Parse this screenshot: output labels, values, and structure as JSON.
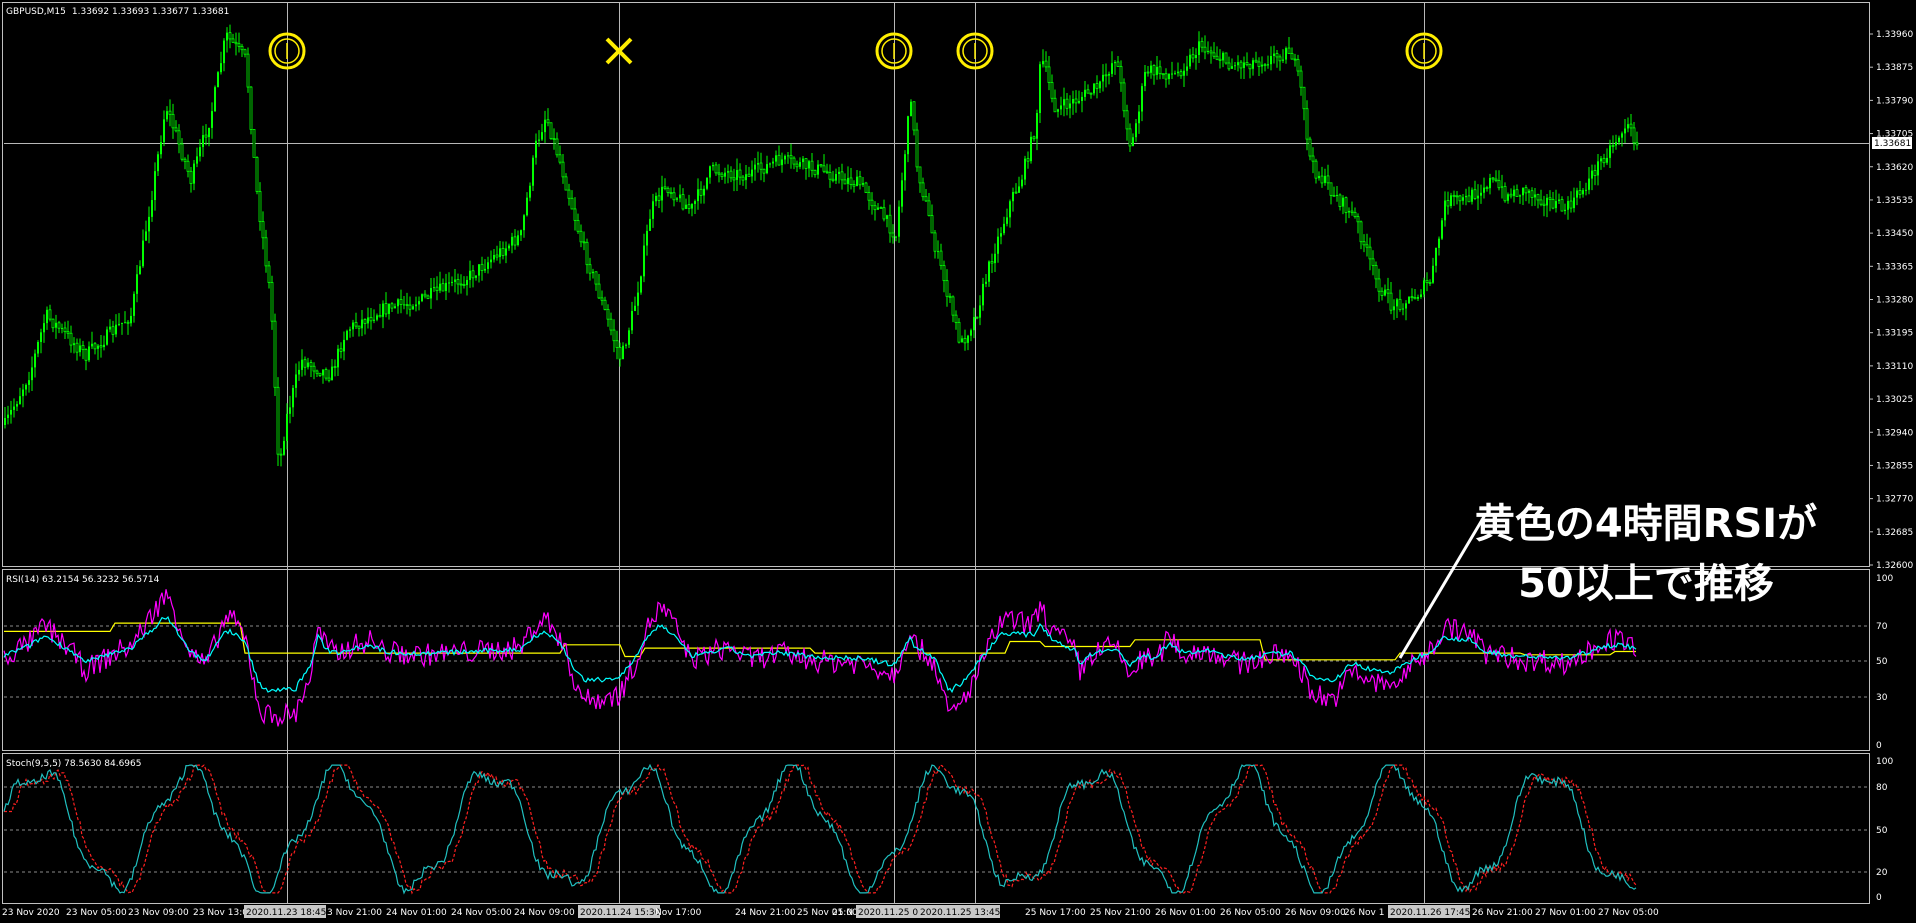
{
  "main_panel": {
    "symbol_label": "GBPUSD,M15",
    "ohlc_values": "1.33692 1.33693 1.33677 1.33681",
    "price_ticks": [
      "1.33960",
      "1.33875",
      "1.33790",
      "1.33705",
      "1.33620",
      "1.33535",
      "1.33450",
      "1.33365",
      "1.33280",
      "1.33195",
      "1.33110",
      "1.33025",
      "1.32940",
      "1.32855",
      "1.32770",
      "1.32685",
      "1.32600"
    ],
    "current_price": "1.33681",
    "markers": [
      {
        "type": "circle-line",
        "color": "#ffee00"
      },
      {
        "type": "cross",
        "color": "#ffee00"
      },
      {
        "type": "circle-line",
        "color": "#ffee00"
      },
      {
        "type": "circle-line",
        "color": "#ffee00"
      },
      {
        "type": "circle-line",
        "color": "#ffee00"
      }
    ],
    "candle_color": "#00ff00",
    "background_color": "#000000"
  },
  "rsi_panel": {
    "label": "RSI(14) 63.2154 56.3232 56.5714",
    "scale_ticks": [
      "100",
      "70",
      "50",
      "30",
      "0"
    ],
    "series_colors": {
      "rsi_m15": "#ff00ff",
      "rsi_h1": "#00ffff",
      "rsi_h4": "#ffff00"
    }
  },
  "stoch_panel": {
    "label": "Stoch(9,5,5) 78.5630 84.6965",
    "scale_ticks": [
      "100",
      "80",
      "50",
      "20",
      "0"
    ],
    "series_colors": {
      "main": "#20c0c0",
      "signal": "#ff2020"
    }
  },
  "time_axis": {
    "labels": [
      "23 Nov 2020",
      "23 Nov 05:00",
      "23 Nov 09:00",
      "23 Nov 13:00",
      "2020.11.23 18:45",
      "3 Nov 21:00",
      "24 Nov 01:00",
      "24 Nov 05:00",
      "24 Nov 09:00",
      "2020.11.24 15:30",
      "Nov 17:00",
      "24 Nov 21:00",
      "25 Nov 01:00",
      "25 N",
      "2020.11.25 08:45",
      "2020.11.25 13:45",
      "25 Nov 17:00",
      "25 Nov 21:00",
      "26 Nov 01:00",
      "26 Nov 05:00",
      "26 Nov 09:00",
      "26 Nov 1",
      "2020.11.26 17:45",
      "26 Nov 21:00",
      "27 Nov 01:00",
      "27 Nov 05:00"
    ]
  },
  "annotation": {
    "line1": "黄色の4時間RSIが",
    "line2": "50以上で推移"
  }
}
